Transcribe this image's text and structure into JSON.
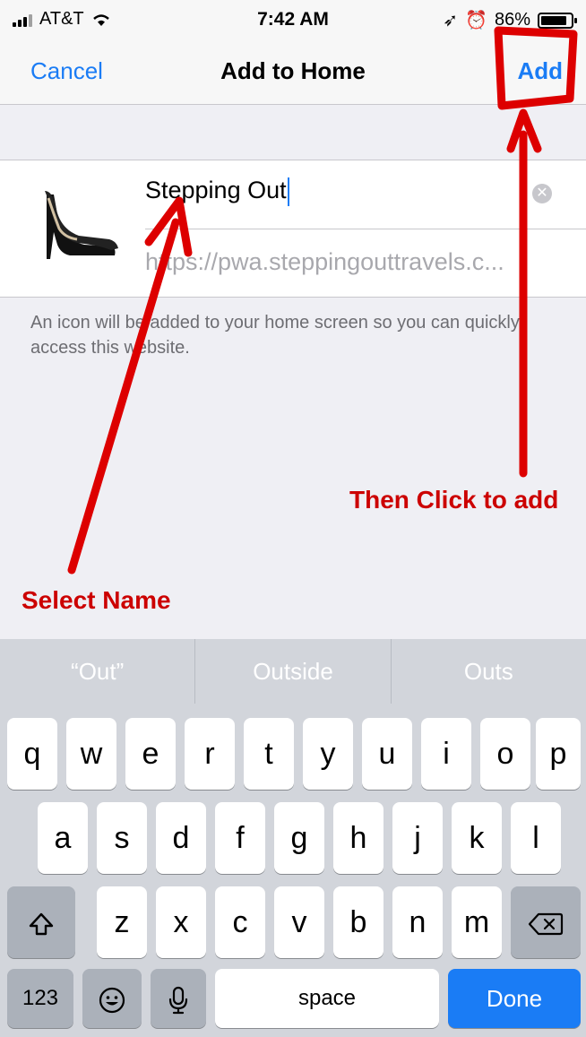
{
  "status": {
    "carrier": "AT&T",
    "time": "7:42 AM",
    "battery": "86%"
  },
  "nav": {
    "cancel": "Cancel",
    "title": "Add to Home",
    "add": "Add"
  },
  "form": {
    "name_value": "Stepping Out",
    "url": "https://pwa.steppingouttravels.c...",
    "hint": "An icon will be added to your home screen so you can quickly access this website."
  },
  "annotations": {
    "then": "Then Click to add",
    "select": "Select Name"
  },
  "suggestions": [
    "“Out”",
    "Outside",
    "Outs"
  ],
  "keyboard": {
    "row1": [
      "q",
      "w",
      "e",
      "r",
      "t",
      "y",
      "u",
      "i",
      "o",
      "p"
    ],
    "row2": [
      "a",
      "s",
      "d",
      "f",
      "g",
      "h",
      "j",
      "k",
      "l"
    ],
    "row3": [
      "z",
      "x",
      "c",
      "v",
      "b",
      "n",
      "m"
    ],
    "numbers": "123",
    "space": "space",
    "done": "Done"
  },
  "colors": {
    "accent": "#1a7cf5",
    "annotation": "#cc0000"
  }
}
